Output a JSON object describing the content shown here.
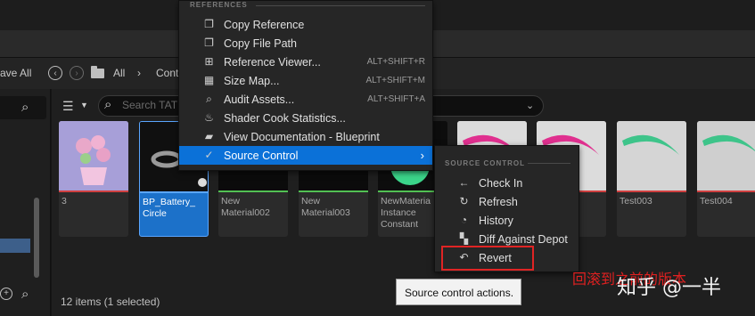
{
  "nav": {
    "save_all": "ave All",
    "all": "All",
    "path_partial": "Cont",
    "separator": "›"
  },
  "search": {
    "placeholder": "Search TAT"
  },
  "assets": [
    {
      "name": "3",
      "selected": false,
      "thumb_color": "#a7a0d6",
      "bar_color": "#d04040"
    },
    {
      "name": "BP_Battery_ Circle",
      "selected": true,
      "thumb_color": "#111111",
      "bar_color": "#5aa6ff"
    },
    {
      "name": "New Material002",
      "selected": false,
      "thumb_color": "#0b0b0b",
      "bar_color": "#52c053"
    },
    {
      "name": "New Material003",
      "selected": false,
      "thumb_color": "#0b0b0b",
      "bar_color": "#52c053"
    },
    {
      "name": "NewMateria Instance Constant",
      "selected": false,
      "thumb_color": "#0d0d0d",
      "bar_color": "#52c053"
    },
    {
      "name": "",
      "selected": false,
      "thumb_color": "#dcdcdc",
      "bar_color": "#d04040"
    },
    {
      "name": "",
      "selected": false,
      "thumb_color": "#dcdcdc",
      "bar_color": "#d04040"
    },
    {
      "name": "Test003",
      "selected": false,
      "thumb_color": "#d5d5d5",
      "bar_color": "#d04040"
    },
    {
      "name": "Test004",
      "selected": false,
      "thumb_color": "#cfcfcf",
      "bar_color": "#d04040"
    }
  ],
  "status_text": "12 items (1 selected)",
  "context_menu": {
    "section": "REFERENCES",
    "items": [
      {
        "label": "Copy Reference",
        "shortcut": "",
        "icon": "copy-icon",
        "glyph": "❐"
      },
      {
        "label": "Copy File Path",
        "shortcut": "",
        "icon": "copy-path-icon",
        "glyph": "❐"
      },
      {
        "label": "Reference Viewer...",
        "shortcut": "ALT+SHIFT+R",
        "icon": "reference-viewer-icon",
        "glyph": "⊞"
      },
      {
        "label": "Size Map...",
        "shortcut": "ALT+SHIFT+M",
        "icon": "size-map-icon",
        "glyph": "▦"
      },
      {
        "label": "Audit Assets...",
        "shortcut": "ALT+SHIFT+A",
        "icon": "audit-icon",
        "glyph": "⌕"
      },
      {
        "label": "Shader Cook Statistics...",
        "shortcut": "",
        "icon": "cook-icon",
        "glyph": "♨"
      },
      {
        "label": "View Documentation - Blueprint",
        "shortcut": "",
        "icon": "documentation-icon",
        "glyph": "▰"
      },
      {
        "label": "Source Control",
        "shortcut": "",
        "icon": "source-control-icon",
        "glyph": "✓",
        "arrow": "›"
      }
    ]
  },
  "submenu": {
    "section": "SOURCE CONTROL",
    "items": [
      {
        "label": "Check In",
        "icon": "check-in-icon",
        "glyph": "←"
      },
      {
        "label": "Refresh",
        "icon": "refresh-icon",
        "glyph": "↻"
      },
      {
        "label": "History",
        "icon": "history-icon",
        "glyph": "◔"
      },
      {
        "label": "Diff Against Depot",
        "icon": "diff-icon",
        "glyph": "▚"
      },
      {
        "label": "Revert",
        "icon": "revert-icon",
        "glyph": "↶"
      }
    ]
  },
  "tooltip": "Source control actions.",
  "annotation": "回滚到之前的版本",
  "watermark": "知乎 @一半"
}
